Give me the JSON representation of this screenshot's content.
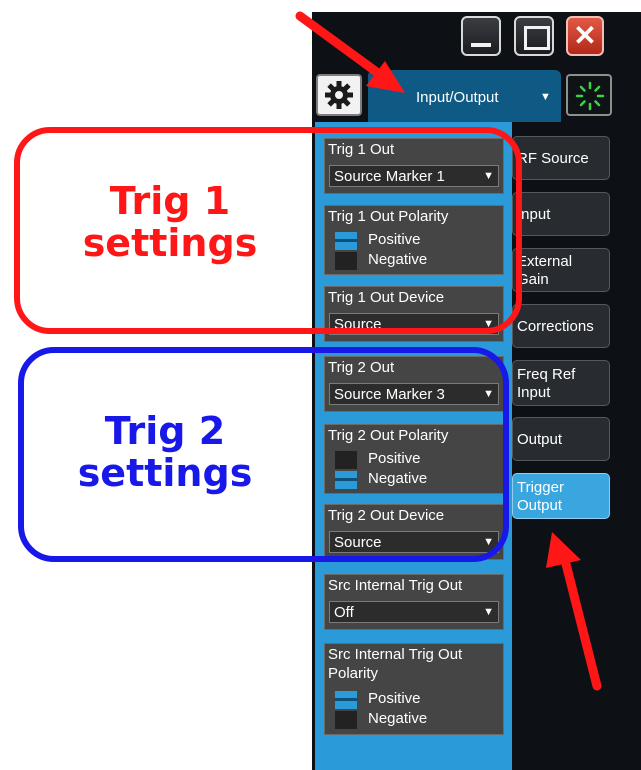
{
  "window": {
    "minimize_icon": "minimize-icon",
    "maximize_icon": "maximize-icon",
    "close_icon": "close-icon",
    "close_glyph": "✕"
  },
  "toolbar": {
    "gear_icon": "gear-icon",
    "menu_label": "Input/Output",
    "menu_caret": "▼",
    "busy_icon": "busy-spinner-icon"
  },
  "controls": {
    "trig1_out": {
      "title": "Trig 1 Out",
      "value": "Source Marker 1"
    },
    "trig1_polarity": {
      "title": "Trig 1 Out Polarity",
      "positive": "Positive",
      "negative": "Negative",
      "selected": "Positive"
    },
    "trig1_device": {
      "title": "Trig 1 Out Device",
      "value": "Source"
    },
    "trig2_out": {
      "title": "Trig 2 Out",
      "value": "Source Marker 3"
    },
    "trig2_polarity": {
      "title": "Trig 2 Out Polarity",
      "positive": "Positive",
      "negative": "Negative",
      "selected": "Negative"
    },
    "trig2_device": {
      "title": "Trig 2 Out Device",
      "value": "Source"
    },
    "src_internal": {
      "title": "Src Internal Trig Out",
      "value": "Off"
    },
    "src_polarity": {
      "title_line1": "Src Internal Trig Out",
      "title_line2": "Polarity",
      "positive": "Positive",
      "negative": "Negative",
      "selected": "Positive"
    }
  },
  "softkeys": [
    {
      "line1": "RF Source",
      "line2": "",
      "active": false
    },
    {
      "line1": "Input",
      "line2": "",
      "active": false
    },
    {
      "line1": "External",
      "line2": "Gain",
      "active": false
    },
    {
      "line1": "Corrections",
      "line2": "",
      "active": false
    },
    {
      "line1": "Freq Ref",
      "line2": "Input",
      "active": false
    },
    {
      "line1": "Output",
      "line2": "",
      "active": false
    },
    {
      "line1": "Trigger",
      "line2": "Output",
      "active": true
    }
  ],
  "annotations": {
    "trig1": {
      "line1": "Trig 1",
      "line2": "settings",
      "color": "#ff1717"
    },
    "trig2": {
      "line1": "Trig 2",
      "line2": "settings",
      "color": "#1818e8"
    }
  },
  "colors": {
    "panel_bg": "#0d1014",
    "accent_blue": "#2a9bd8",
    "tab_blue": "#0f5a84",
    "active_softkey": "#3aa6df",
    "arrow_red": "#ff1717"
  }
}
